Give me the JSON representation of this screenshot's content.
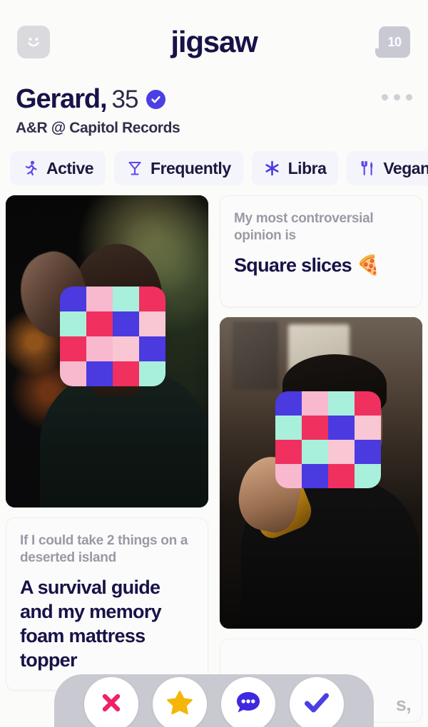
{
  "app": {
    "brand": "jigsaw",
    "accent_color": "#4b3fe4",
    "text_color": "#171348",
    "background": "#fbfbfa"
  },
  "topbar": {
    "smiley_icon": "smiley-icon",
    "chat_icon": "chat-bubble-icon",
    "chat_badge_count": "10"
  },
  "profile": {
    "name": "Gerard,",
    "age": "35",
    "verified_icon": "verified-check-icon",
    "tagline": "A&R @ Capitol Records",
    "overflow_icon": "more-options-icon",
    "chips": [
      {
        "icon": "running-person-icon",
        "glyph": "🏃",
        "label": "Active"
      },
      {
        "icon": "cocktail-glass-icon",
        "glyph": "🍸",
        "label": "Frequently"
      },
      {
        "icon": "sparkle-asterisk-icon",
        "glyph": "✳",
        "label": "Libra"
      },
      {
        "icon": "fork-knife-icon",
        "glyph": "🍴",
        "label": "Vegan"
      }
    ]
  },
  "feed": {
    "photo_one_alt": "profile-photo-night-street",
    "photo_two_alt": "profile-photo-bar-drink",
    "prompts": [
      {
        "question": "My most controversial opinion is",
        "answer": "Square slices 🍕"
      },
      {
        "question": "If I could take 2 things on a deserted island",
        "answer": "A survival guide and my memory foam mattress topper"
      }
    ],
    "partial_text": "s,"
  },
  "actions": [
    {
      "name": "pass-button",
      "icon": "x-icon",
      "color": "#ee2365"
    },
    {
      "name": "superlike-button",
      "icon": "star-icon",
      "color": "#f5b609"
    },
    {
      "name": "message-button",
      "icon": "chat-dots-icon",
      "color": "#3f28e0"
    },
    {
      "name": "like-button",
      "icon": "check-icon",
      "color": "#4b3fe4"
    }
  ],
  "jigsaw_colors": {
    "blue": "#4a3ae0",
    "mint": "#a8f0dc",
    "pink": "#f8b9cf",
    "crimson": "#f0305f",
    "lightpink": "#f9c6d4"
  }
}
